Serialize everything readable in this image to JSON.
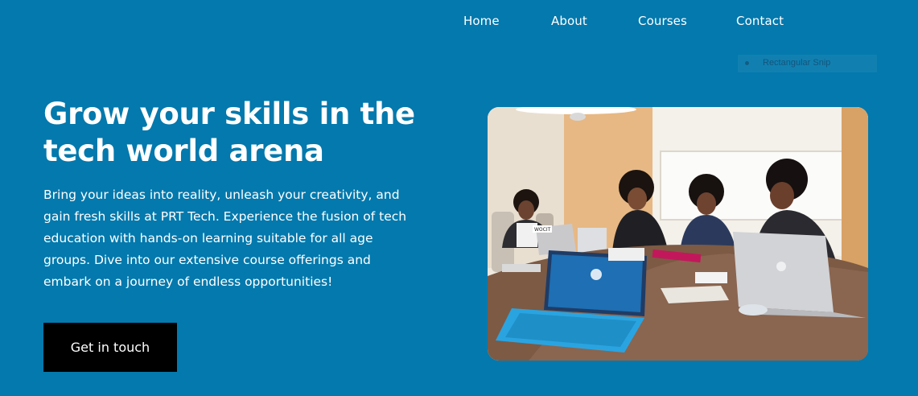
{
  "nav": {
    "items": [
      {
        "label": "Home"
      },
      {
        "label": "About"
      },
      {
        "label": "Courses"
      },
      {
        "label": "Contact"
      }
    ]
  },
  "overlay": {
    "snip_label": "Rectangular Snip"
  },
  "hero": {
    "title_line1": "Grow your skills in the",
    "title_line2": "tech world arena",
    "description_lines": [
      "Bring your ideas into reality, unleash your creativity, and",
      "gain fresh skills at PRT Tech. Experience the fusion of tech",
      "education with hands-on learning suitable for all age",
      "groups. Dive into our extensive course offerings and",
      "embark on a journey of endless opportunities!"
    ],
    "cta_label": "Get in touch",
    "photo_sticker_text": "WOCIT"
  },
  "colors": {
    "background": "#0379ad",
    "cta_background": "#000000",
    "text": "#ffffff"
  }
}
